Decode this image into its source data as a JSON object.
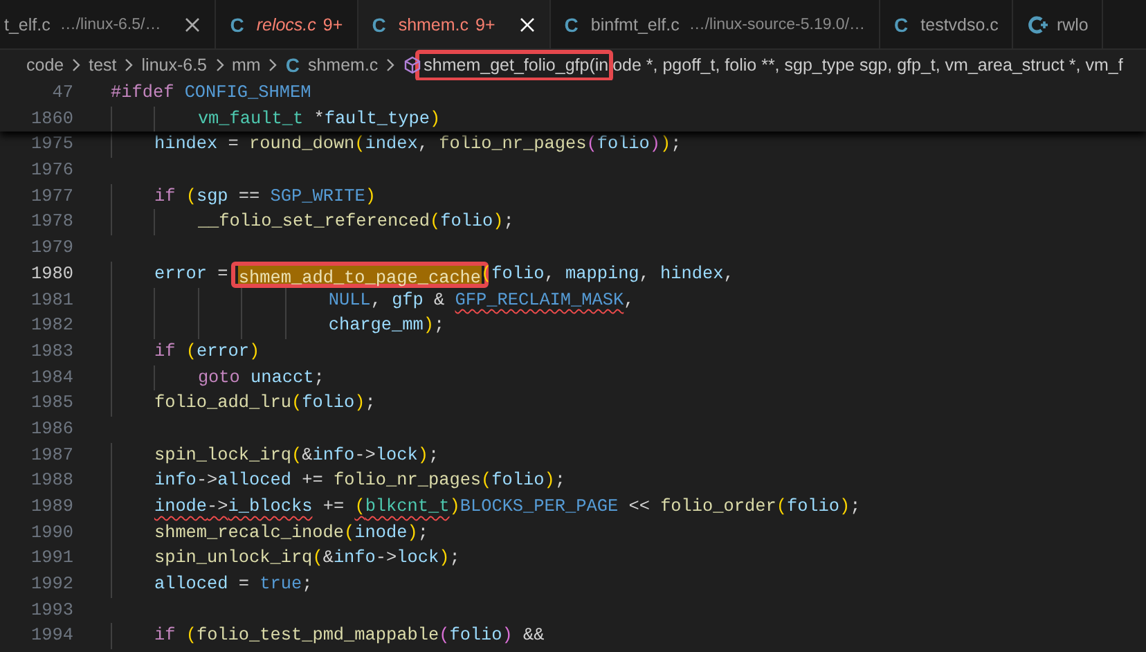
{
  "tabs": [
    {
      "label": "t_elf.c",
      "path": "…/linux-6.5/…",
      "error": false,
      "preview": false,
      "close_visible": true,
      "selected": false
    },
    {
      "kind": "c",
      "icon": "C",
      "label": "relocs.c",
      "problems": "9+",
      "error": true,
      "preview": true,
      "close_visible": false,
      "selected": false
    },
    {
      "kind": "c",
      "icon": "C",
      "label": "shmem.c",
      "problems": "9+",
      "error": true,
      "preview": false,
      "close_visible": true,
      "selected": true
    },
    {
      "kind": "c",
      "icon": "C",
      "label": "binfmt_elf.c",
      "path": "…/linux-source-5.19.0/…",
      "error": false,
      "preview": false,
      "close_visible": false,
      "selected": false
    },
    {
      "kind": "c",
      "icon": "C",
      "label": "testvdso.c",
      "error": false,
      "preview": false,
      "close_visible": false,
      "selected": false
    },
    {
      "kind": "cpp",
      "label": "rwlo",
      "error": false,
      "preview": false,
      "close_visible": false,
      "selected": false
    }
  ],
  "breadcrumb": [
    {
      "kind": "folder",
      "label": "code"
    },
    {
      "kind": "folder",
      "label": "test"
    },
    {
      "kind": "folder",
      "label": "linux-6.5"
    },
    {
      "kind": "folder",
      "label": "mm"
    },
    {
      "kind": "file",
      "icon": "C",
      "label": "shmem.c"
    },
    {
      "kind": "symbol",
      "parts": [
        {
          "text": "shmem_get_folio_gfp(in",
          "boxed": true
        },
        {
          "text": "ode *, pgoff_t, folio **, sgp_type sgp, gfp_t, vm_area_struct *, vm_f",
          "boxed": false
        }
      ]
    }
  ],
  "sticky_lines": [
    {
      "number": "47",
      "current": false,
      "segments": [
        {
          "kind": "code",
          "text": "#ifdef CONFIG_SHMEM"
        }
      ]
    },
    {
      "number": "1860",
      "current": false,
      "segments": [
        {
          "kind": "code",
          "text": "        vm_fault_t *fault_type)"
        }
      ]
    }
  ],
  "lines": [
    {
      "number": "1975",
      "current": false,
      "segments": [
        {
          "kind": "code",
          "text": "    hindex = round_down(index, folio_nr_pages(folio));"
        }
      ]
    },
    {
      "number": "1976",
      "current": false
    },
    {
      "number": "1977",
      "current": false,
      "segments": [
        {
          "kind": "code",
          "text": "    if (sgp == SGP_WRITE)"
        }
      ]
    },
    {
      "number": "1978",
      "current": false,
      "segments": [
        {
          "kind": "code",
          "text": "        __folio_set_referenced(folio);"
        }
      ]
    },
    {
      "number": "1979",
      "current": false
    },
    {
      "number": "1980",
      "current": true,
      "segments": [
        {
          "kind": "code",
          "text": "    error = "
        },
        {
          "kind": "match",
          "text": "shmem_add_to_page_cache"
        },
        {
          "kind": "code",
          "text": "(folio, mapping, hindex,"
        }
      ]
    },
    {
      "number": "1981",
      "current": false,
      "segments": [
        {
          "kind": "code",
          "text": "                    NULL, gfp & "
        },
        {
          "kind": "error",
          "text": "GFP_RECLAIM_MASK"
        },
        {
          "kind": "code",
          "text": ","
        }
      ]
    },
    {
      "number": "1982",
      "current": false,
      "segments": [
        {
          "kind": "code",
          "text": "                    charge_mm);"
        }
      ]
    },
    {
      "number": "1983",
      "current": false,
      "segments": [
        {
          "kind": "code",
          "text": "    if (error)"
        }
      ]
    },
    {
      "number": "1984",
      "current": false,
      "segments": [
        {
          "kind": "code",
          "text": "        goto unacct;"
        }
      ]
    },
    {
      "number": "1985",
      "current": false,
      "segments": [
        {
          "kind": "code",
          "text": "    folio_add_lru(folio);"
        }
      ]
    },
    {
      "number": "1986",
      "current": false
    },
    {
      "number": "1987",
      "current": false,
      "segments": [
        {
          "kind": "code",
          "text": "    spin_lock_irq(&info->lock);"
        }
      ]
    },
    {
      "number": "1988",
      "current": false,
      "segments": [
        {
          "kind": "code",
          "text": "    info->alloced += folio_nr_pages(folio);"
        }
      ]
    },
    {
      "number": "1989",
      "current": false,
      "segments": [
        {
          "kind": "error",
          "text": "    inode->i_blocks"
        },
        {
          "kind": "code",
          "text": " += "
        },
        {
          "kind": "error",
          "text": "(blkcnt_t"
        },
        {
          "kind": "code",
          "text": ")BLOCKS_PER_PAGE << folio_order(folio);"
        }
      ]
    },
    {
      "number": "1990",
      "current": false,
      "segments": [
        {
          "kind": "code",
          "text": "    shmem_recalc_inode(inode);"
        }
      ]
    },
    {
      "number": "1991",
      "current": false,
      "segments": [
        {
          "kind": "code",
          "text": "    spin_unlock_irq(&info->lock);"
        }
      ]
    },
    {
      "number": "1992",
      "current": false,
      "segments": [
        {
          "kind": "code",
          "text": "    alloced = true;"
        }
      ]
    },
    {
      "number": "1993",
      "current": false
    },
    {
      "number": "1994",
      "current": false,
      "segments": [
        {
          "kind": "code",
          "text": "    if (folio_test_pmd_mappable(folio) &&"
        }
      ]
    }
  ]
}
